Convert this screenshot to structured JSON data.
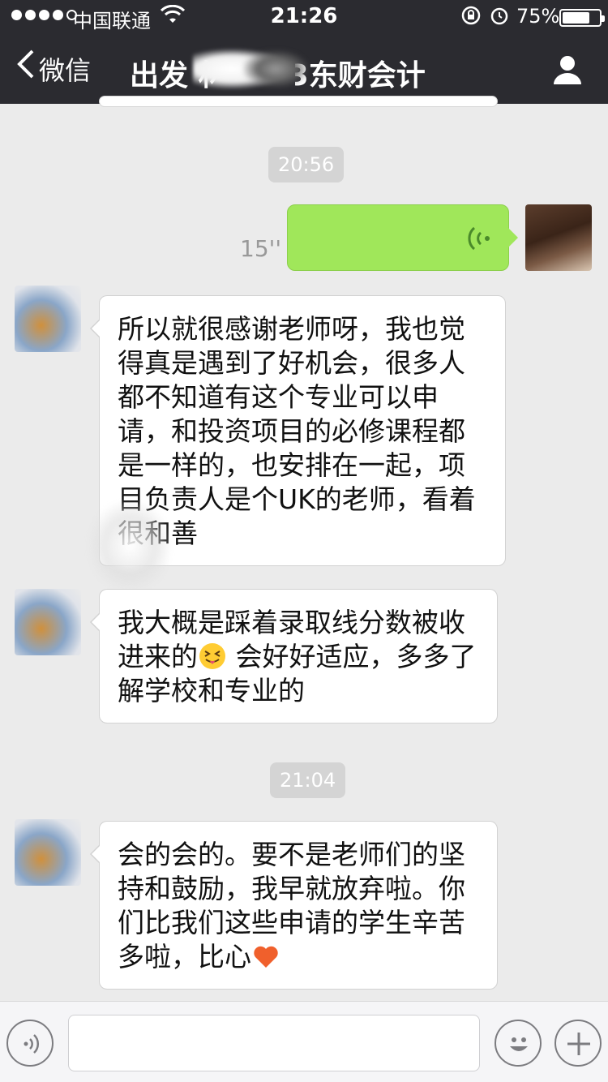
{
  "status_bar": {
    "carrier": "中国联通",
    "time": "21:26",
    "battery_percent": "75%",
    "battery_level": 0.75
  },
  "nav": {
    "back_label": "微信",
    "title": "出发               林2013东财会计"
  },
  "chat": {
    "timestamps": [
      "20:56",
      "21:04"
    ],
    "voice_message": {
      "duration": "15''"
    },
    "messages": [
      {
        "text": "所以就很感谢老师呀，我也觉得真是遇到了好机会，很多人都不知道有这个专业可以申请，和投资项目的必修课程都是一样的，也安排在一起，项目负责人是个UK的老师，看着很和善"
      },
      {
        "text_before": "我大概是踩着录取线分数被收进来的",
        "emoji": "tongue-squint-emoji",
        "text_after": " 会好好适应，多多了解学校和专业的"
      },
      {
        "text": "会的会的。要不是老师们的坚持和鼓励，我早就放弃啦。你们比我们这些申请的学生辛苦多啦，比心",
        "emoji": "heart-emoji"
      }
    ]
  },
  "colors": {
    "nav_bg": "#2b2b30",
    "chat_bg": "#ebebeb",
    "voice_bubble": "#a0e75a",
    "timestamp_bg": "#d4d4d4"
  },
  "icons": [
    "back-chevron-icon",
    "person-icon",
    "wifi-icon",
    "lock-icon",
    "alarm-icon",
    "voice-wave-icon",
    "voice-input-icon",
    "emoji-icon",
    "plus-icon"
  ]
}
